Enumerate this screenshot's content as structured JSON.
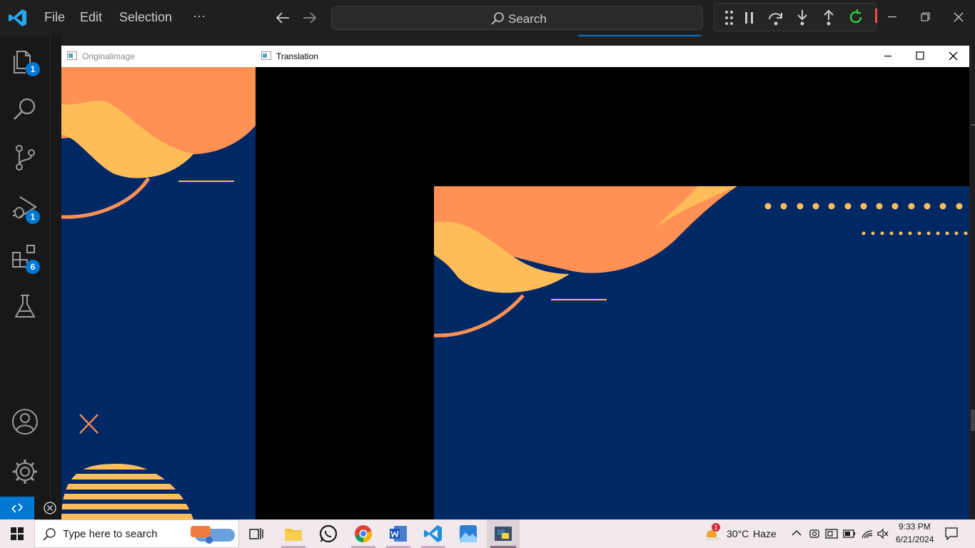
{
  "vscode": {
    "menu": [
      "File",
      "Edit",
      "Selection",
      "···"
    ],
    "search_label": "Search",
    "activity_badges": {
      "explorer": "1",
      "run_debug": "1",
      "extensions": "6"
    },
    "accent_color": "#0078d4"
  },
  "original_window": {
    "title": "Originalimage"
  },
  "translation_window": {
    "title": "Translation"
  },
  "image_colors": {
    "navy": "#002864",
    "orange": "#ff9155",
    "yellow": "#ffbd5a",
    "black": "#000000"
  },
  "taskbar": {
    "search_placeholder": "Type here to search",
    "weather_temp": "30°C",
    "weather_desc": "Haze",
    "weather_badge": "1",
    "time": "9:33 PM",
    "date": "6/21/2024"
  }
}
